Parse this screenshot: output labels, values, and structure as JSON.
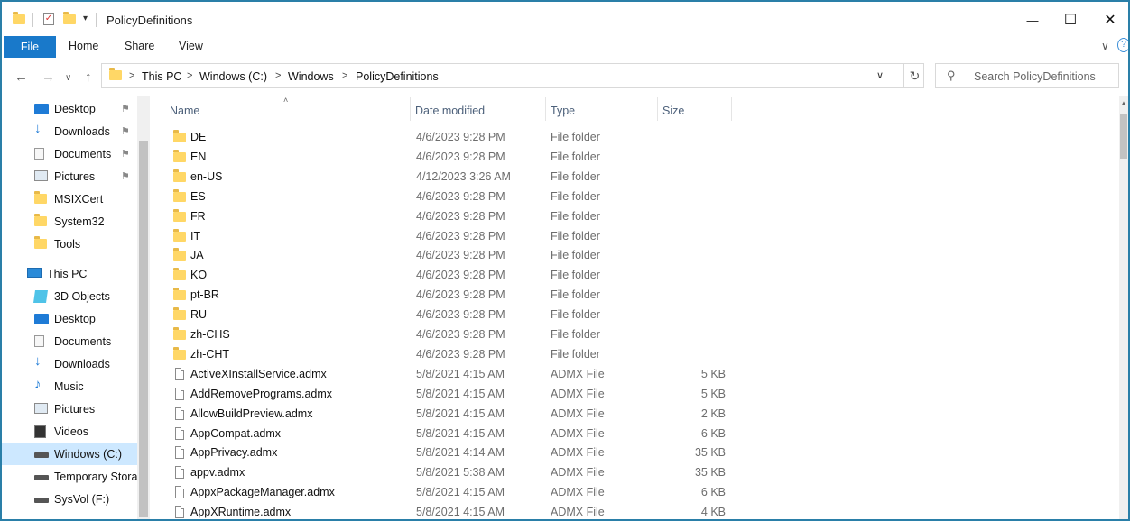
{
  "window": {
    "title": "PolicyDefinitions",
    "minimize_glyph": "—",
    "maximize_glyph": "☐",
    "close_glyph": "✕"
  },
  "ribbon": {
    "file_tab": "File",
    "tabs": [
      "Home",
      "Share",
      "View"
    ],
    "expand_glyph": "∨",
    "help_glyph": "?"
  },
  "address": {
    "crumbs": [
      "This PC",
      "Windows (C:)",
      "Windows",
      "PolicyDefinitions"
    ],
    "separator": ">",
    "dropdown_glyph": "∨",
    "refresh_glyph": "↻"
  },
  "search": {
    "placeholder": "Search PolicyDefinitions"
  },
  "nav": {
    "back_glyph": "←",
    "forward_glyph": "→",
    "recent_glyph": "∨",
    "up_glyph": "↑",
    "pin_glyph": "⚑",
    "items": [
      {
        "label": "Desktop",
        "icon": "desktop-icon",
        "pinned": true
      },
      {
        "label": "Downloads",
        "icon": "downloads-icon",
        "pinned": true
      },
      {
        "label": "Documents",
        "icon": "documents-icon",
        "pinned": true
      },
      {
        "label": "Pictures",
        "icon": "pictures-icon",
        "pinned": true
      },
      {
        "label": "MSIXCert",
        "icon": "folder-icon",
        "pinned": false
      },
      {
        "label": "System32",
        "icon": "folder-icon",
        "pinned": false
      },
      {
        "label": "Tools",
        "icon": "folder-icon",
        "pinned": false
      },
      {
        "label": "This PC",
        "icon": "computer-icon",
        "pinned": false
      },
      {
        "label": "3D Objects",
        "icon": "3d-objects-icon",
        "pinned": false
      },
      {
        "label": "Desktop",
        "icon": "desktop-icon",
        "pinned": false
      },
      {
        "label": "Documents",
        "icon": "documents-icon",
        "pinned": false
      },
      {
        "label": "Downloads",
        "icon": "downloads-icon",
        "pinned": false
      },
      {
        "label": "Music",
        "icon": "music-icon",
        "pinned": false
      },
      {
        "label": "Pictures",
        "icon": "pictures-icon",
        "pinned": false
      },
      {
        "label": "Videos",
        "icon": "videos-icon",
        "pinned": false
      },
      {
        "label": "Windows (C:)",
        "icon": "drive-icon",
        "pinned": false,
        "selected": true
      },
      {
        "label": "Temporary Stora",
        "icon": "drive-icon",
        "pinned": false
      },
      {
        "label": "SysVol (F:)",
        "icon": "drive-icon",
        "pinned": false
      }
    ]
  },
  "columns": {
    "name": "Name",
    "date": "Date modified",
    "type": "Type",
    "size": "Size",
    "sort_glyph": "˄"
  },
  "files": [
    {
      "name": "DE",
      "date": "4/6/2023 9:28 PM",
      "type": "File folder",
      "size": "",
      "kind": "folder"
    },
    {
      "name": "EN",
      "date": "4/6/2023 9:28 PM",
      "type": "File folder",
      "size": "",
      "kind": "folder"
    },
    {
      "name": "en-US",
      "date": "4/12/2023 3:26 AM",
      "type": "File folder",
      "size": "",
      "kind": "folder"
    },
    {
      "name": "ES",
      "date": "4/6/2023 9:28 PM",
      "type": "File folder",
      "size": "",
      "kind": "folder"
    },
    {
      "name": "FR",
      "date": "4/6/2023 9:28 PM",
      "type": "File folder",
      "size": "",
      "kind": "folder"
    },
    {
      "name": "IT",
      "date": "4/6/2023 9:28 PM",
      "type": "File folder",
      "size": "",
      "kind": "folder"
    },
    {
      "name": "JA",
      "date": "4/6/2023 9:28 PM",
      "type": "File folder",
      "size": "",
      "kind": "folder"
    },
    {
      "name": "KO",
      "date": "4/6/2023 9:28 PM",
      "type": "File folder",
      "size": "",
      "kind": "folder"
    },
    {
      "name": "pt-BR",
      "date": "4/6/2023 9:28 PM",
      "type": "File folder",
      "size": "",
      "kind": "folder"
    },
    {
      "name": "RU",
      "date": "4/6/2023 9:28 PM",
      "type": "File folder",
      "size": "",
      "kind": "folder"
    },
    {
      "name": "zh-CHS",
      "date": "4/6/2023 9:28 PM",
      "type": "File folder",
      "size": "",
      "kind": "folder"
    },
    {
      "name": "zh-CHT",
      "date": "4/6/2023 9:28 PM",
      "type": "File folder",
      "size": "",
      "kind": "folder"
    },
    {
      "name": "ActiveXInstallService.admx",
      "date": "5/8/2021 4:15 AM",
      "type": "ADMX File",
      "size": "5 KB",
      "kind": "file"
    },
    {
      "name": "AddRemovePrograms.admx",
      "date": "5/8/2021 4:15 AM",
      "type": "ADMX File",
      "size": "5 KB",
      "kind": "file"
    },
    {
      "name": "AllowBuildPreview.admx",
      "date": "5/8/2021 4:15 AM",
      "type": "ADMX File",
      "size": "2 KB",
      "kind": "file"
    },
    {
      "name": "AppCompat.admx",
      "date": "5/8/2021 4:15 AM",
      "type": "ADMX File",
      "size": "6 KB",
      "kind": "file"
    },
    {
      "name": "AppPrivacy.admx",
      "date": "5/8/2021 4:14 AM",
      "type": "ADMX File",
      "size": "35 KB",
      "kind": "file"
    },
    {
      "name": "appv.admx",
      "date": "5/8/2021 5:38 AM",
      "type": "ADMX File",
      "size": "35 KB",
      "kind": "file"
    },
    {
      "name": "AppxPackageManager.admx",
      "date": "5/8/2021 4:15 AM",
      "type": "ADMX File",
      "size": "6 KB",
      "kind": "file"
    },
    {
      "name": "AppXRuntime.admx",
      "date": "5/8/2021 4:15 AM",
      "type": "ADMX File",
      "size": "4 KB",
      "kind": "file"
    }
  ],
  "colors": {
    "accent": "#1979ca",
    "selection": "#cde8ff",
    "folder": "#ffd766",
    "frame_border": "#2a7fa8"
  }
}
